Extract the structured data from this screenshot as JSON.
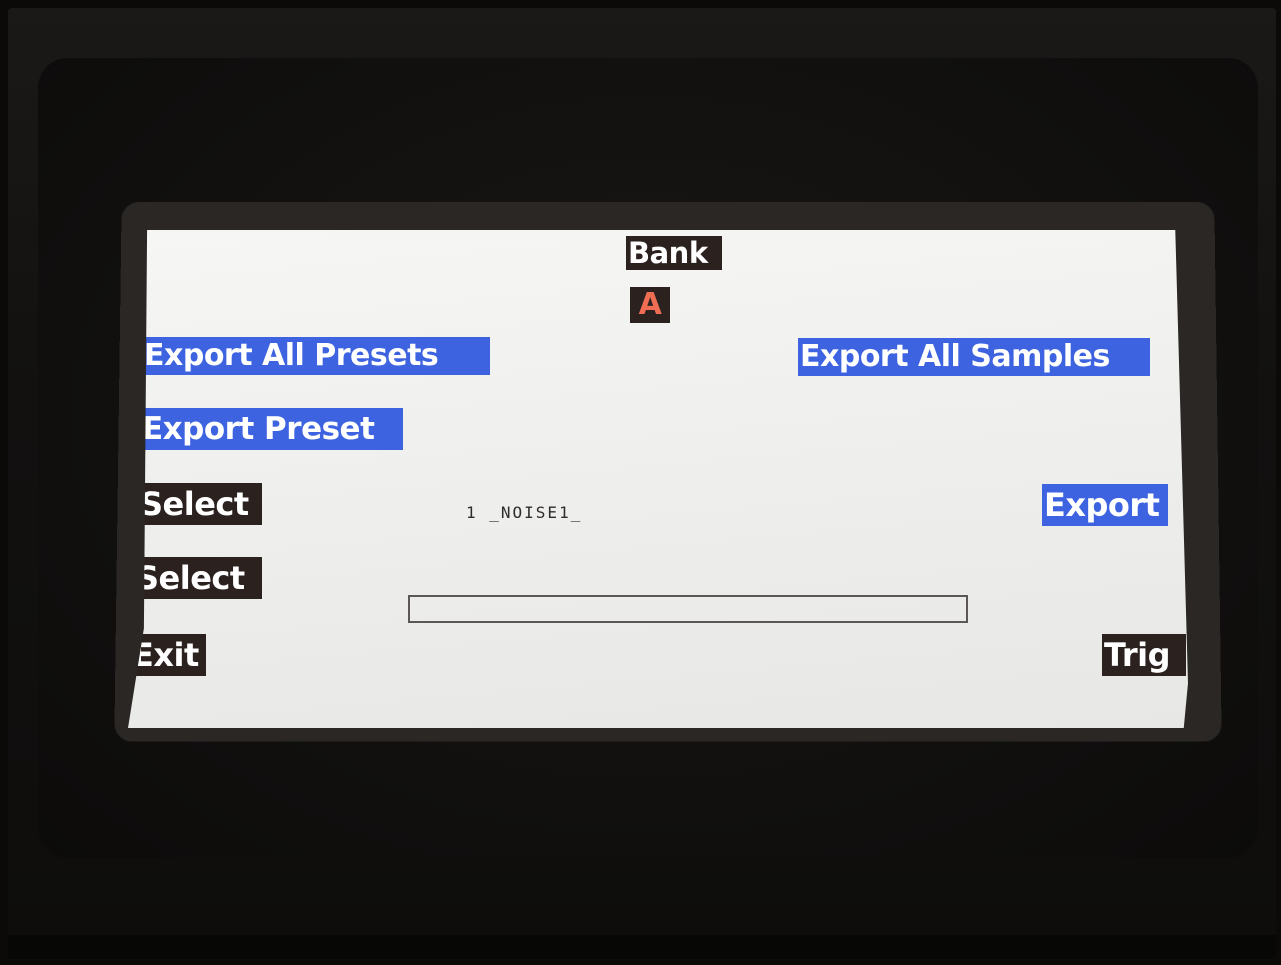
{
  "screen": {
    "bank": {
      "label": "Bank",
      "value": "A"
    },
    "buttons": {
      "export_all_presets": "Export All Presets",
      "export_all_samples": "Export All Samples",
      "export_preset": "Export Preset",
      "select_1": "Select",
      "select_2": "Select",
      "exit": "Exit",
      "export": "Export",
      "trig": "Trig"
    },
    "sample": {
      "name": "1 _NOISE1_"
    },
    "progress": {
      "value_percent": 0
    }
  },
  "colors": {
    "highlight_blue": "#3d63e0",
    "label_dark": "#2b2220",
    "bank_value_orange": "#ef6d53",
    "lcd_background": "#efefed",
    "device_body": "#121110"
  }
}
